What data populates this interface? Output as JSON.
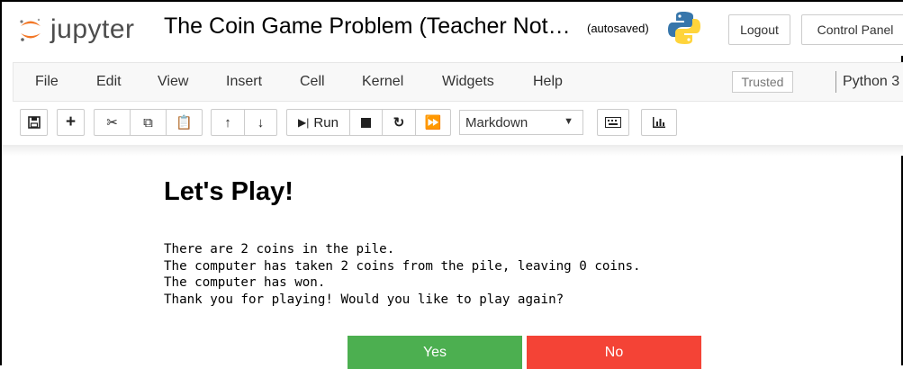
{
  "header": {
    "logo_text": "jupyter",
    "notebook_title": "The Coin Game Problem (Teacher Not…",
    "autosave_status": "(autosaved)",
    "logout_label": "Logout",
    "control_panel_label": "Control Panel"
  },
  "menu": {
    "items": [
      "File",
      "Edit",
      "View",
      "Insert",
      "Cell",
      "Kernel",
      "Widgets",
      "Help"
    ],
    "trusted_label": "Trusted",
    "kernel_name": "Python 3"
  },
  "toolbar": {
    "run_label": "Run",
    "cell_type": "Markdown",
    "icons": [
      "save-icon",
      "plus-icon",
      "cut-icon",
      "copy-icon",
      "paste-icon",
      "arrow-up-icon",
      "arrow-down-icon",
      "run-icon",
      "stop-icon",
      "restart-icon",
      "fast-forward-icon",
      "keyboard-icon",
      "chart-icon"
    ]
  },
  "cell": {
    "heading": "Let's Play!",
    "output_lines": [
      "There are 2 coins in the pile.",
      "The computer has taken 2 coins from the pile, leaving 0 coins.",
      "The computer has won.",
      "Thank you for playing! Would you like to play again?"
    ],
    "yes_label": "Yes",
    "no_label": "No"
  },
  "colors": {
    "yes_button": "#4caf50",
    "no_button": "#f44336",
    "jupyter_orange": "#f37726"
  }
}
